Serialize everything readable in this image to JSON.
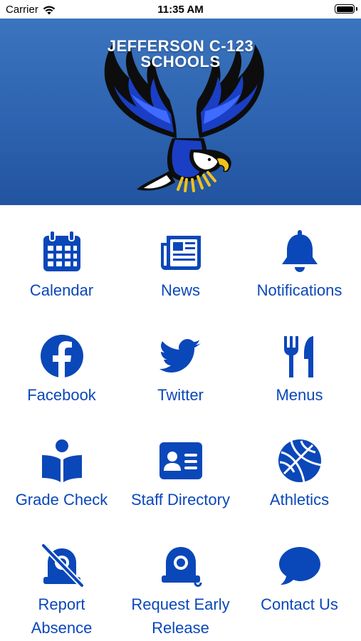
{
  "status_bar": {
    "carrier": "Carrier",
    "time": "11:35 AM"
  },
  "header": {
    "title_line1": "JEFFERSON C-123",
    "title_line2": "SCHOOLS"
  },
  "colors": {
    "accent": "#0a47b9",
    "header_top": "#3b74be",
    "header_bottom": "#2254a0"
  },
  "tiles": [
    {
      "label": "Calendar",
      "icon": "calendar-icon"
    },
    {
      "label": "News",
      "icon": "newspaper-icon"
    },
    {
      "label": "Notifications",
      "icon": "bell-icon"
    },
    {
      "label": "Facebook",
      "icon": "facebook-icon"
    },
    {
      "label": "Twitter",
      "icon": "twitter-icon"
    },
    {
      "label": "Menus",
      "icon": "utensils-icon"
    },
    {
      "label": "Grade Check",
      "icon": "reader-icon"
    },
    {
      "label": "Staff Directory",
      "icon": "id-card-icon"
    },
    {
      "label": "Athletics",
      "icon": "basketball-icon"
    },
    {
      "label": "Report",
      "label2": "Absence",
      "icon": "alarm-off-icon"
    },
    {
      "label": "Request Early",
      "label2": "Release",
      "icon": "alarm-bell-icon"
    },
    {
      "label": "Contact Us",
      "icon": "chat-bubble-icon"
    }
  ]
}
